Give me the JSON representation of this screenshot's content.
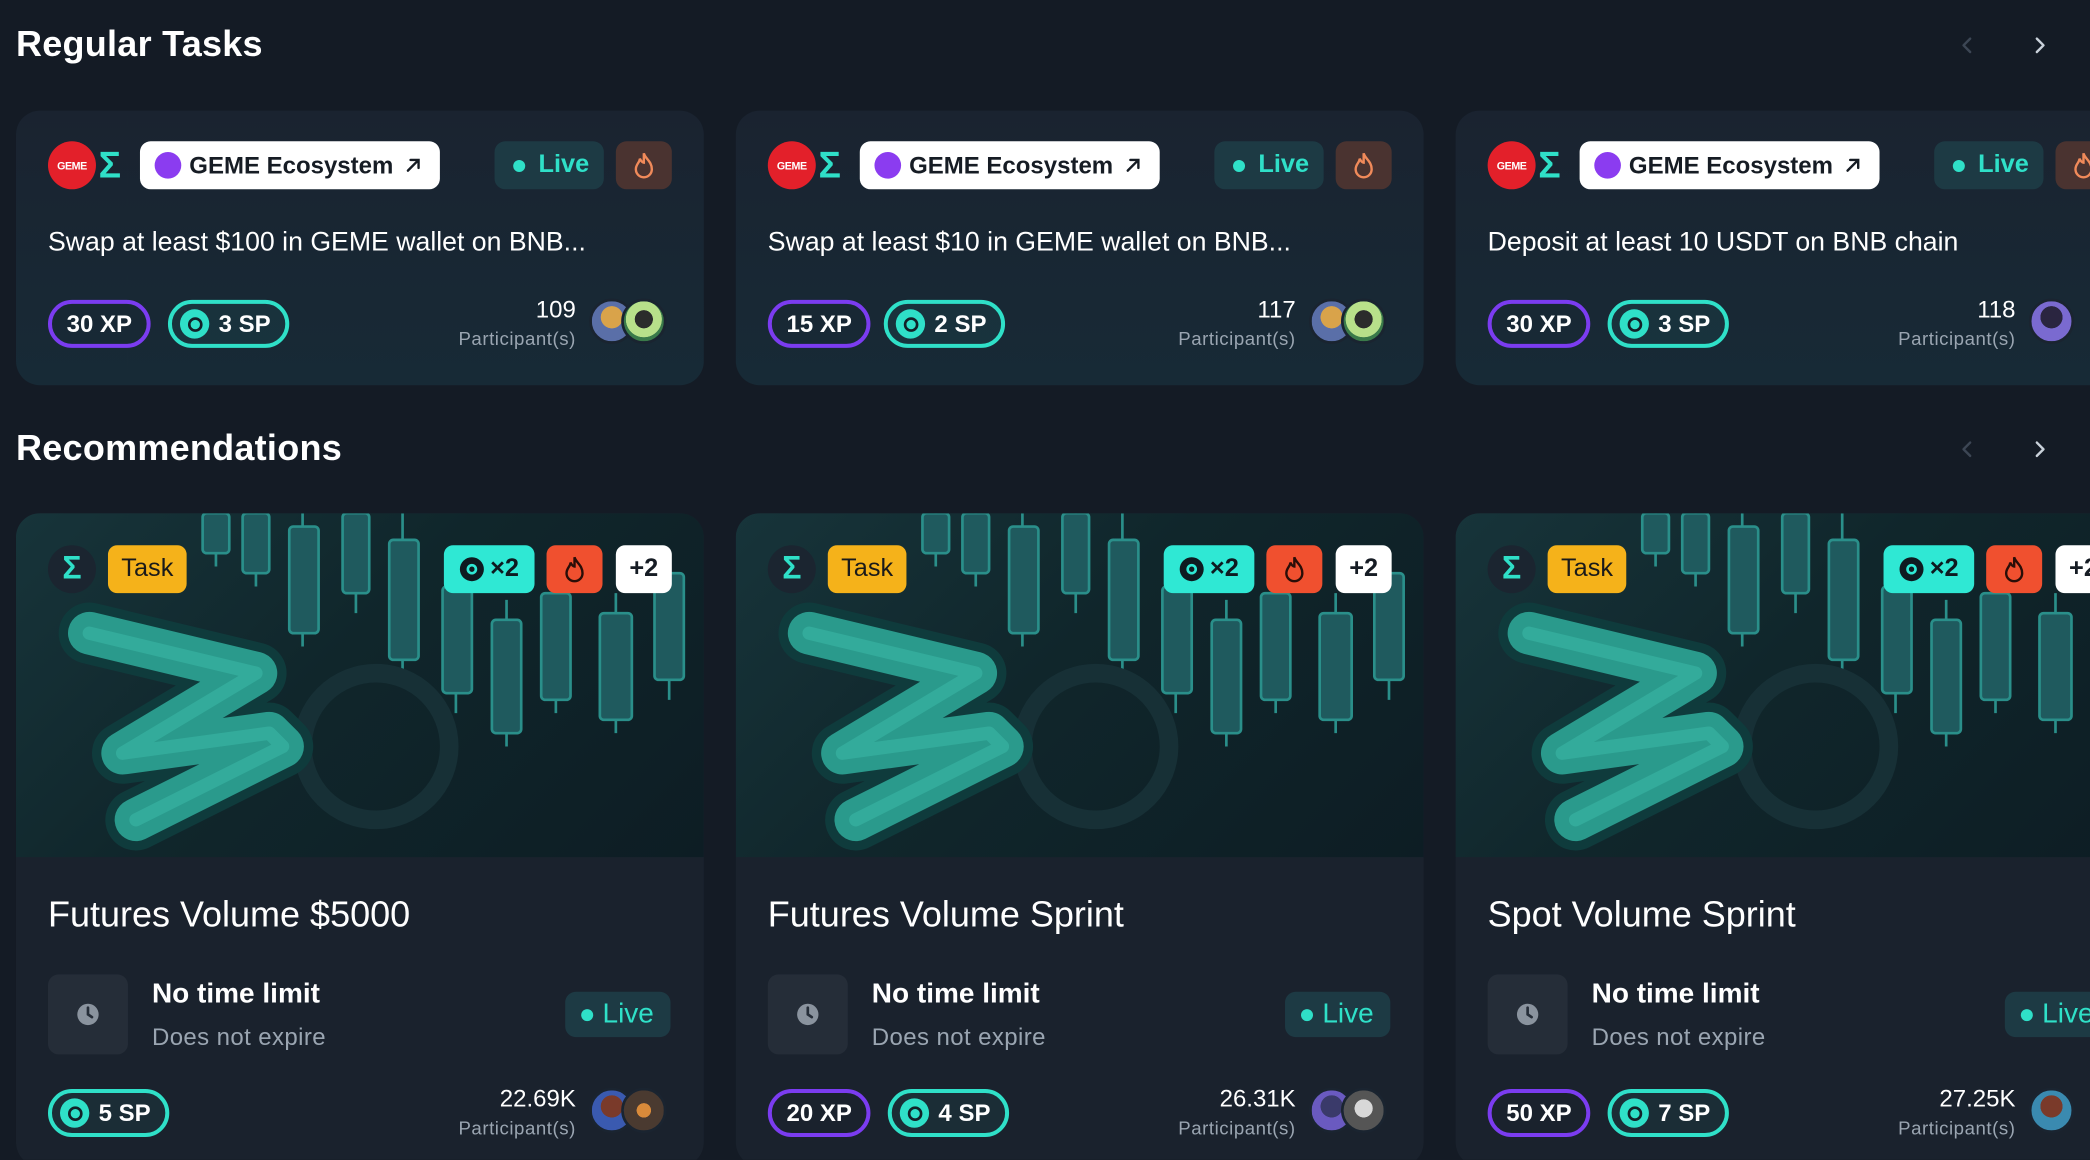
{
  "colors": {
    "background": "#141b25",
    "accent_teal": "#2fe0c8",
    "xp_purple": "#7b3cf0",
    "task_orange": "#f5b21a",
    "fire_red": "#f0502f",
    "geme_red": "#e3202a"
  },
  "regular_tasks": {
    "title": "Regular Tasks",
    "cards": [
      {
        "brand_logo_text": "GEME",
        "ecosystem_label": "GEME Ecosystem",
        "status": "Live",
        "title": "Swap at least $100 in GEME wallet on BNB...",
        "xp": "30 XP",
        "sp": "3 SP",
        "participants": "109",
        "participants_label": "Participant(s)"
      },
      {
        "brand_logo_text": "GEME",
        "ecosystem_label": "GEME Ecosystem",
        "status": "Live",
        "title": "Swap at least $10 in GEME wallet on BNB...",
        "xp": "15 XP",
        "sp": "2 SP",
        "participants": "117",
        "participants_label": "Participant(s)"
      },
      {
        "brand_logo_text": "GEME",
        "ecosystem_label": "GEME Ecosystem",
        "status": "Live",
        "title": "Deposit at least 10 USDT on BNB chain",
        "xp": "30 XP",
        "sp": "3 SP",
        "participants": "118",
        "participants_label": "Participant(s)"
      }
    ]
  },
  "recommendations": {
    "title": "Recommendations",
    "cards": [
      {
        "sigma": "Σ",
        "tag": "Task",
        "boost": "×2",
        "extra": "+2",
        "title": "Futures Volume $5000",
        "limit_title": "No time limit",
        "limit_sub": "Does not expire",
        "status": "Live",
        "xp": "",
        "sp": "5 SP",
        "participants": "22.69K",
        "participants_label": "Participant(s)"
      },
      {
        "sigma": "Σ",
        "tag": "Task",
        "boost": "×2",
        "extra": "+2",
        "title": "Futures Volume Sprint",
        "limit_title": "No time limit",
        "limit_sub": "Does not expire",
        "status": "Live",
        "xp": "20 XP",
        "sp": "4 SP",
        "participants": "26.31K",
        "participants_label": "Participant(s)"
      },
      {
        "sigma": "Σ",
        "tag": "Task",
        "boost": "×2",
        "extra": "+2",
        "title": "Spot Volume Sprint",
        "limit_title": "No time limit",
        "limit_sub": "Does not expire",
        "status": "Live",
        "xp": "50 XP",
        "sp": "7 SP",
        "participants": "27.25K",
        "participants_label": "Participant(s)"
      }
    ]
  }
}
